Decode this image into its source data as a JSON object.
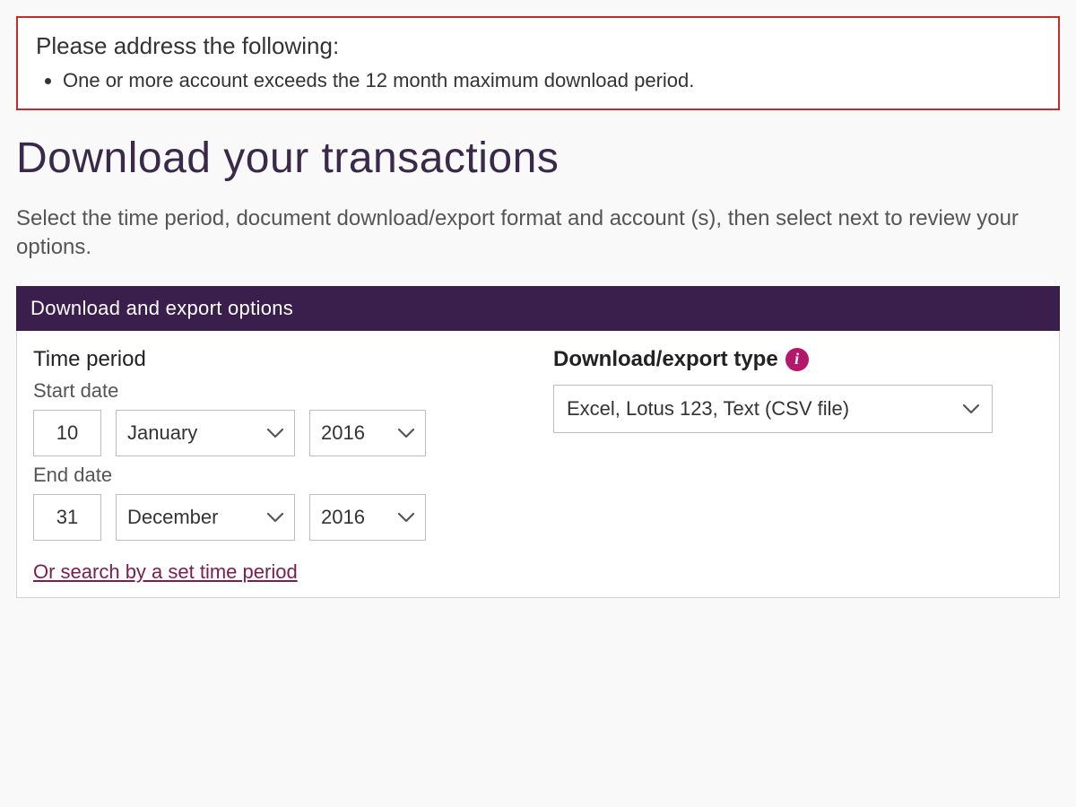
{
  "error": {
    "title": "Please address the following:",
    "items": [
      "One or more account exceeds the 12 month maximum download period."
    ]
  },
  "page": {
    "title": "Download your transactions",
    "intro": "Select the time period, document download/export format and account (s), then select next to review your options."
  },
  "panel": {
    "header": "Download and export options",
    "time_period_label": "Time period",
    "start_date_label": "Start date",
    "end_date_label": "End date",
    "start": {
      "day": "10",
      "month": "January",
      "year": "2016"
    },
    "end": {
      "day": "31",
      "month": "December",
      "year": "2016"
    },
    "alt_link": "Or search by a set time period",
    "export_type_label": "Download/export type",
    "export_value": "Excel, Lotus 123, Text (CSV file)",
    "info_glyph": "i"
  }
}
